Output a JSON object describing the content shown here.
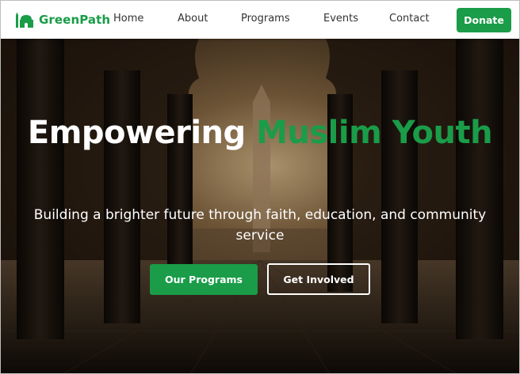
{
  "colors": {
    "brand_green": "#1a9c48",
    "nav_text": "#333333",
    "hero_text": "#ffffff"
  },
  "navbar": {
    "brand": {
      "icon": "mosque-icon",
      "name": "GreenPath"
    },
    "links": [
      {
        "label": "Home"
      },
      {
        "label": "About"
      },
      {
        "label": "Programs"
      },
      {
        "label": "Events"
      },
      {
        "label": "Contact"
      }
    ],
    "donate_label": "Donate"
  },
  "hero": {
    "title_part1": "Empowering ",
    "title_accent": "Muslim Youth",
    "subtitle": "Building a brighter future through faith, education, and community service",
    "primary_button": "Our Programs",
    "secondary_button": "Get Involved"
  }
}
